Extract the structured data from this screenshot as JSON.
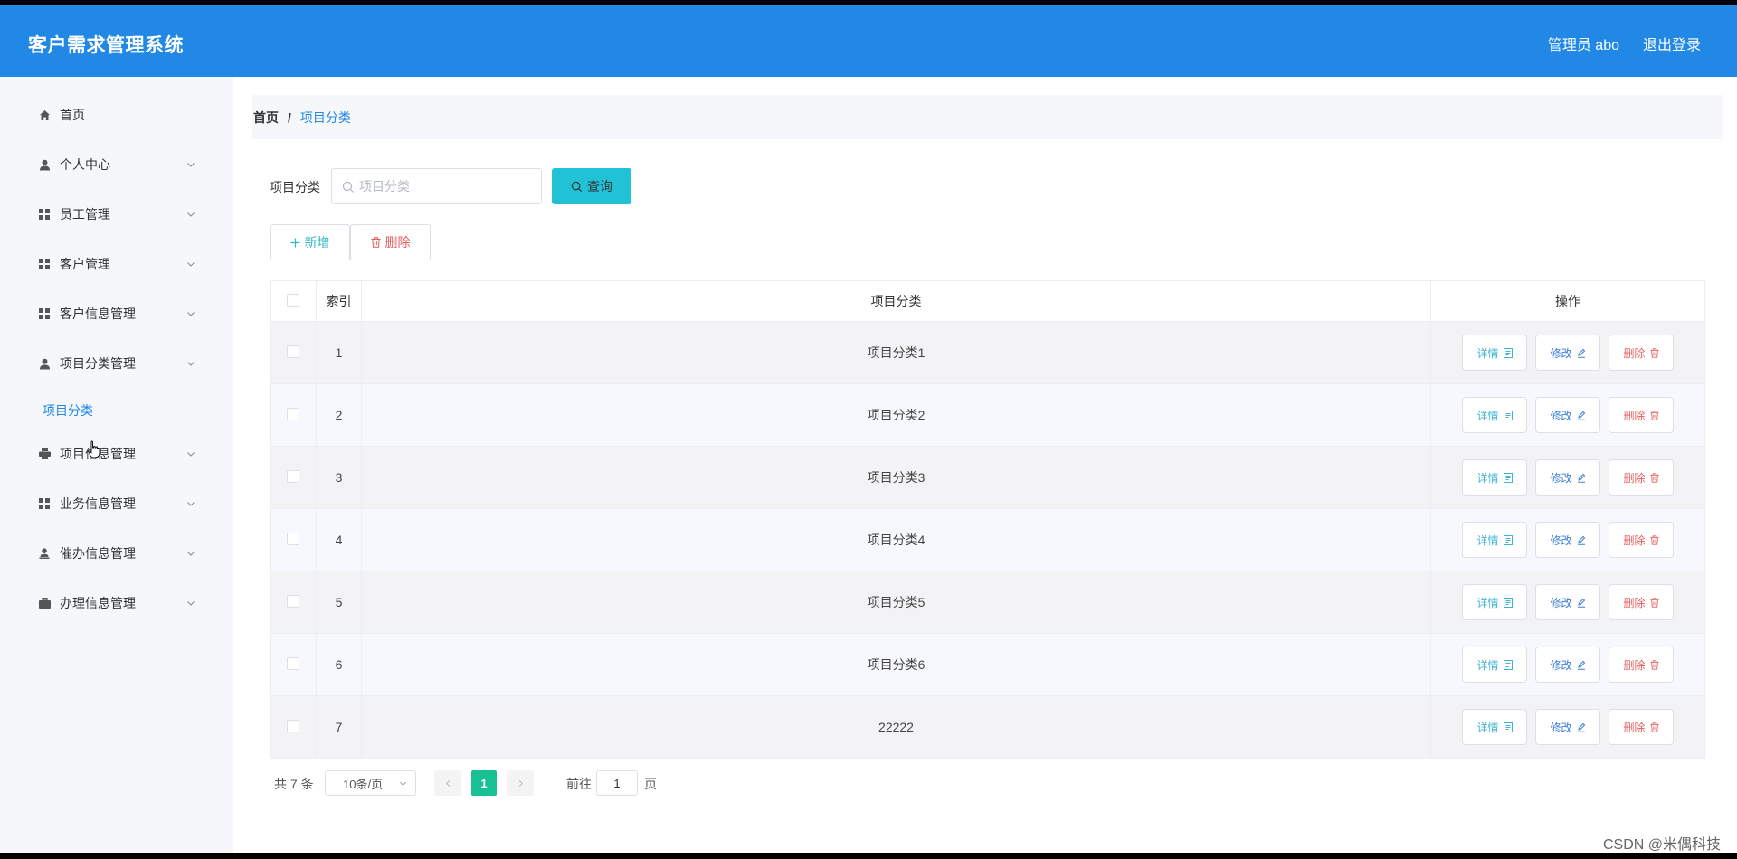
{
  "app": {
    "title": "客户需求管理系统"
  },
  "header": {
    "admin_label": "管理员 abo",
    "logout_label": "退出登录"
  },
  "sidebar": {
    "items": [
      {
        "label": "首页",
        "icon": "home-icon"
      },
      {
        "label": "个人中心",
        "icon": "user-icon"
      },
      {
        "label": "员工管理",
        "icon": "grid-icon"
      },
      {
        "label": "客户管理",
        "icon": "grid-icon"
      },
      {
        "label": "客户信息管理",
        "icon": "grid-icon"
      },
      {
        "label": "项目分类管理",
        "icon": "user-icon"
      },
      {
        "label": "项目信息管理",
        "icon": "printer-icon"
      },
      {
        "label": "业务信息管理",
        "icon": "grid-icon"
      },
      {
        "label": "催办信息管理",
        "icon": "person-stamp-icon"
      },
      {
        "label": "办理信息管理",
        "icon": "briefcase-icon"
      }
    ],
    "subitem": {
      "label": "项目分类"
    }
  },
  "breadcrumb": {
    "home": "首页",
    "separator": "/",
    "current": "项目分类"
  },
  "search": {
    "label": "项目分类",
    "placeholder": "项目分类",
    "value": "",
    "button": "查询"
  },
  "actions": {
    "add": "新增",
    "delete": "删除"
  },
  "table": {
    "headers": {
      "index": "索引",
      "name": "项目分类",
      "ops": "操作"
    },
    "rows": [
      {
        "index": "1",
        "name": "项目分类1"
      },
      {
        "index": "2",
        "name": "项目分类2"
      },
      {
        "index": "3",
        "name": "项目分类3"
      },
      {
        "index": "4",
        "name": "项目分类4"
      },
      {
        "index": "5",
        "name": "项目分类5"
      },
      {
        "index": "6",
        "name": "项目分类6"
      },
      {
        "index": "7",
        "name": "22222"
      }
    ],
    "row_ops": {
      "detail": "详情",
      "edit": "修改",
      "delete": "删除"
    }
  },
  "pagination": {
    "total": "共 7 条",
    "page_size": "10条/页",
    "current_page": "1",
    "goto_label": "前往",
    "goto_value": "1",
    "page_unit": "页"
  },
  "watermark": "CSDN @米偶科技",
  "colors": {
    "header": "#2188e5",
    "accent": "#21c1d6",
    "page_active": "#18c193",
    "danger": "#e45b5b"
  }
}
